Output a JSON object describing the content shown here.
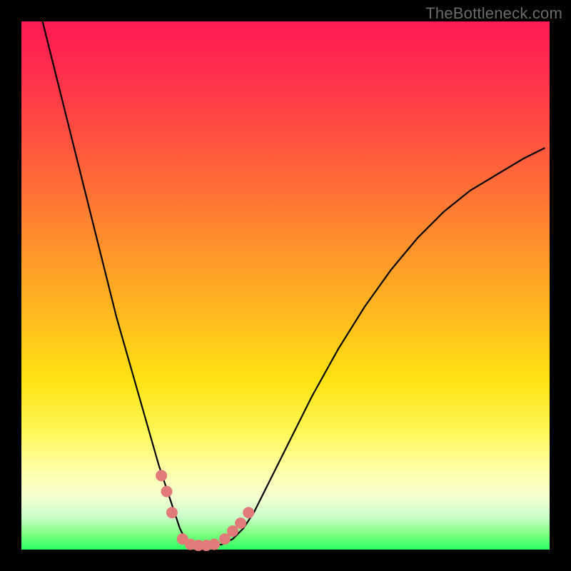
{
  "watermark": "TheBottleneck.com",
  "chart_data": {
    "type": "line",
    "title": "",
    "xlabel": "",
    "ylabel": "",
    "xlim": [
      0,
      100
    ],
    "ylim": [
      0,
      100
    ],
    "series": [
      {
        "name": "curve",
        "x": [
          4,
          6,
          8,
          10,
          12,
          14,
          16,
          18,
          20,
          22,
          24,
          26,
          28,
          29,
          30,
          31,
          32,
          33,
          34,
          36,
          38,
          40,
          42,
          44,
          46,
          50,
          55,
          60,
          65,
          70,
          75,
          80,
          85,
          90,
          95,
          99
        ],
        "values": [
          100,
          92,
          84,
          76,
          68,
          60,
          52,
          44,
          37,
          30,
          23,
          16,
          10,
          7,
          4,
          2,
          1,
          0.5,
          0.5,
          0.6,
          1,
          2,
          4,
          7,
          11,
          19,
          29,
          38,
          46,
          53,
          59,
          64,
          68,
          71,
          74,
          76
        ]
      }
    ],
    "markers": [
      {
        "x": 26.5,
        "y": 14
      },
      {
        "x": 27.5,
        "y": 11
      },
      {
        "x": 28.5,
        "y": 7
      },
      {
        "x": 30.5,
        "y": 2
      },
      {
        "x": 32.0,
        "y": 1
      },
      {
        "x": 33.5,
        "y": 0.8
      },
      {
        "x": 35.0,
        "y": 0.8
      },
      {
        "x": 36.5,
        "y": 1
      },
      {
        "x": 38.5,
        "y": 2
      },
      {
        "x": 40.0,
        "y": 3.5
      },
      {
        "x": 41.5,
        "y": 5
      },
      {
        "x": 43.0,
        "y": 7
      }
    ],
    "background_gradient": {
      "stops": [
        {
          "pos": 0,
          "color": "#ff1a53"
        },
        {
          "pos": 25,
          "color": "#ff5a3d"
        },
        {
          "pos": 55,
          "color": "#ffb81f"
        },
        {
          "pos": 78,
          "color": "#fff85a"
        },
        {
          "pos": 90,
          "color": "#f5ffd0"
        },
        {
          "pos": 100,
          "color": "#2cff63"
        }
      ]
    }
  }
}
